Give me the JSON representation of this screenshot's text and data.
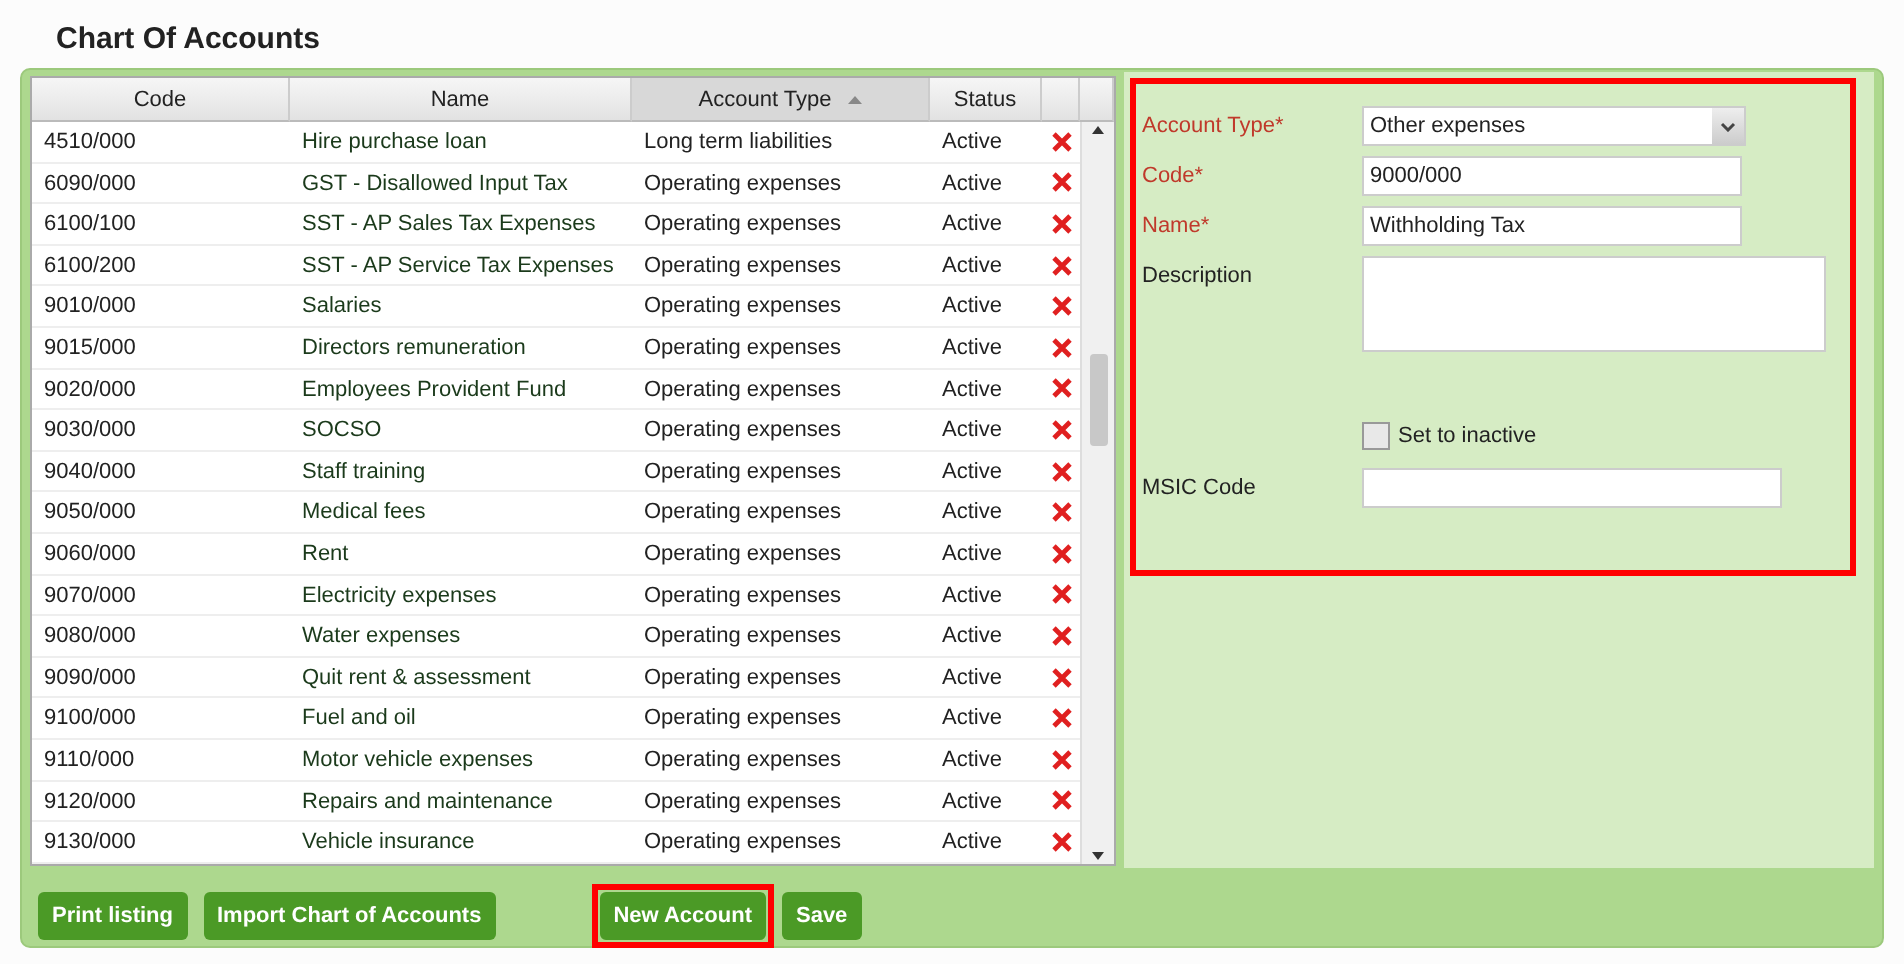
{
  "title": "Chart Of Accounts",
  "table": {
    "columns": [
      {
        "label": "Code",
        "sorted": false
      },
      {
        "label": "Name",
        "sorted": false
      },
      {
        "label": "Account Type",
        "sorted": true
      },
      {
        "label": "Status",
        "sorted": false
      }
    ],
    "rows": [
      {
        "code": "4510/000",
        "name": "Hire purchase loan",
        "type": "Long term liabilities",
        "status": "Active"
      },
      {
        "code": "6090/000",
        "name": "GST - Disallowed Input Tax",
        "type": "Operating expenses",
        "status": "Active"
      },
      {
        "code": "6100/100",
        "name": "SST - AP Sales Tax Expenses",
        "type": "Operating expenses",
        "status": "Active"
      },
      {
        "code": "6100/200",
        "name": "SST - AP Service Tax Expenses",
        "type": "Operating expenses",
        "status": "Active"
      },
      {
        "code": "9010/000",
        "name": "Salaries",
        "type": "Operating expenses",
        "status": "Active"
      },
      {
        "code": "9015/000",
        "name": "Directors remuneration",
        "type": "Operating expenses",
        "status": "Active"
      },
      {
        "code": "9020/000",
        "name": "Employees Provident Fund",
        "type": "Operating expenses",
        "status": "Active"
      },
      {
        "code": "9030/000",
        "name": "SOCSO",
        "type": "Operating expenses",
        "status": "Active"
      },
      {
        "code": "9040/000",
        "name": "Staff training",
        "type": "Operating expenses",
        "status": "Active"
      },
      {
        "code": "9050/000",
        "name": "Medical fees",
        "type": "Operating expenses",
        "status": "Active"
      },
      {
        "code": "9060/000",
        "name": "Rent",
        "type": "Operating expenses",
        "status": "Active"
      },
      {
        "code": "9070/000",
        "name": "Electricity expenses",
        "type": "Operating expenses",
        "status": "Active"
      },
      {
        "code": "9080/000",
        "name": "Water expenses",
        "type": "Operating expenses",
        "status": "Active"
      },
      {
        "code": "9090/000",
        "name": "Quit rent & assessment",
        "type": "Operating expenses",
        "status": "Active"
      },
      {
        "code": "9100/000",
        "name": "Fuel and oil",
        "type": "Operating expenses",
        "status": "Active"
      },
      {
        "code": "9110/000",
        "name": "Motor vehicle expenses",
        "type": "Operating expenses",
        "status": "Active"
      },
      {
        "code": "9120/000",
        "name": "Repairs and maintenance",
        "type": "Operating expenses",
        "status": "Active"
      },
      {
        "code": "9130/000",
        "name": "Vehicle insurance",
        "type": "Operating expenses",
        "status": "Active"
      }
    ]
  },
  "form": {
    "highlighted": true,
    "fields": [
      {
        "kind": "select",
        "label": "Account Type*",
        "required": true,
        "value": "Other expenses"
      },
      {
        "kind": "text",
        "label": "Code*",
        "required": true,
        "value": "9000/000"
      },
      {
        "kind": "text",
        "label": "Name*",
        "required": true,
        "value": "Withholding Tax"
      },
      {
        "kind": "textarea",
        "label": "Description",
        "required": false
      },
      {
        "kind": "checkbox",
        "label": "Set to inactive",
        "checked": false
      },
      {
        "kind": "text",
        "label": "MSIC Code",
        "required": false
      }
    ]
  },
  "buttons": [
    {
      "label": "Print listing",
      "highlighted": false
    },
    {
      "label": "Import Chart of Accounts",
      "highlighted": false
    },
    {
      "label": "New Account",
      "highlighted": true
    },
    {
      "label": "Save",
      "highlighted": false
    }
  ]
}
